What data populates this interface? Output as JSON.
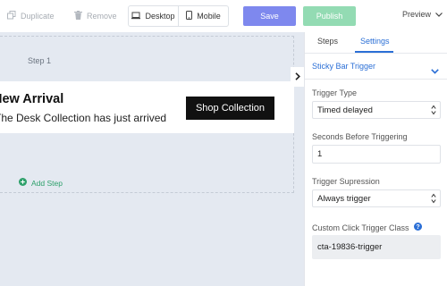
{
  "toolbar": {
    "duplicate_label": "Duplicate",
    "remove_label": "Remove",
    "desktop_label": "Desktop",
    "mobile_label": "Mobile",
    "save_label": "Save",
    "publish_label": "Publish",
    "preview_label": "Preview"
  },
  "canvas": {
    "step_label": "Step 1",
    "card_title": "New Arrival",
    "card_subtitle": "The Desk Collection has just arrived",
    "shop_button_label": "Shop Collection",
    "add_step_label": "Add Step"
  },
  "panel": {
    "tabs": [
      {
        "label": "Steps"
      },
      {
        "label": "Settings"
      }
    ],
    "section_title": "Sticky Bar Trigger",
    "fields": {
      "trigger_type": {
        "label": "Trigger Type",
        "value": "Timed delayed"
      },
      "seconds": {
        "label": "Seconds Before Triggering",
        "value": "1"
      },
      "suppression": {
        "label": "Trigger Supression",
        "value": "Always trigger"
      },
      "click_class": {
        "label": "Custom Click Trigger Class",
        "value": "cta-19836-trigger"
      }
    }
  },
  "colors": {
    "accent_blue": "#2b6fd6",
    "save": "#7e88ee",
    "publish": "#93dbb3",
    "add_step_green": "#2ea06b",
    "canvas_bg": "#e4e9f1"
  },
  "icons": [
    "duplicate-icon",
    "trash-icon",
    "desktop-icon",
    "mobile-icon",
    "chevron-down-icon",
    "chevron-right-icon",
    "plus-circle-icon",
    "help-icon",
    "select-arrows-icon"
  ]
}
